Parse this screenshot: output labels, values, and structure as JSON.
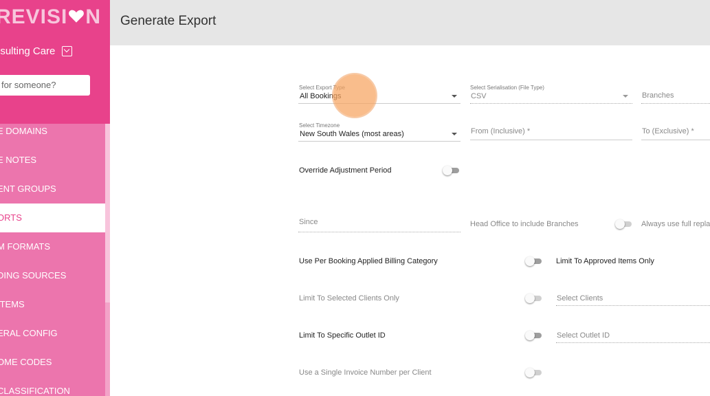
{
  "sidebar": {
    "logo_text": "REVISI",
    "logo_text_end": "N",
    "org_name": "nsulting Care",
    "search_placeholder": "for someone?",
    "items": [
      {
        "label": "E DOMAINS",
        "active": false
      },
      {
        "label": "E NOTES",
        "active": false
      },
      {
        "label": "ENT GROUPS",
        "active": false
      },
      {
        "label": "ORTS",
        "active": true
      },
      {
        "label": "M FORMATS",
        "active": false
      },
      {
        "label": "DING SOURCES",
        "active": false
      },
      {
        "label": "ITEMS",
        "active": false
      },
      {
        "label": "ERAL CONFIG",
        "active": false
      },
      {
        "label": "OME CODES",
        "active": false
      },
      {
        "label": "CLASSIFICATION",
        "active": false
      }
    ]
  },
  "header": {
    "title": "Generate Export"
  },
  "form": {
    "export_type": {
      "label": "Select Export Type",
      "value": "All Bookings"
    },
    "serialisation": {
      "label": "Select Serialisation (File Type)",
      "value": "CSV"
    },
    "branches": {
      "placeholder": "Branches"
    },
    "timezone": {
      "label": "Select Timezone",
      "value": "New South Wales (most areas)"
    },
    "from": {
      "placeholder": "From (Inclusive) *"
    },
    "to": {
      "placeholder": "To (Exclusive) *"
    },
    "override_adjustment": {
      "label": "Override Adjustment Period",
      "checked": false
    },
    "since": {
      "placeholder": "Since"
    },
    "head_office": {
      "label": "Head Office to include Branches",
      "checked": false
    },
    "always_full": {
      "label": "Always use full repla"
    },
    "per_booking_billing": {
      "label": "Use Per Booking Applied Billing Category",
      "checked": false
    },
    "limit_approved": {
      "label": "Limit To Approved Items Only"
    },
    "limit_clients": {
      "label": "Limit To Selected Clients Only",
      "checked": false
    },
    "select_clients": {
      "placeholder": "Select Clients"
    },
    "limit_outlet": {
      "label": "Limit To Specific Outlet ID",
      "checked": false
    },
    "select_outlet": {
      "placeholder": "Select Outlet ID"
    },
    "single_invoice": {
      "label": "Use a Single Invoice Number per Client",
      "checked": false
    }
  },
  "colors": {
    "sidebar_top": "#e8428b",
    "sidebar_nav": "#ec75ad",
    "header_bg": "#e6e6e6",
    "click_indicator": "#f6a460"
  }
}
